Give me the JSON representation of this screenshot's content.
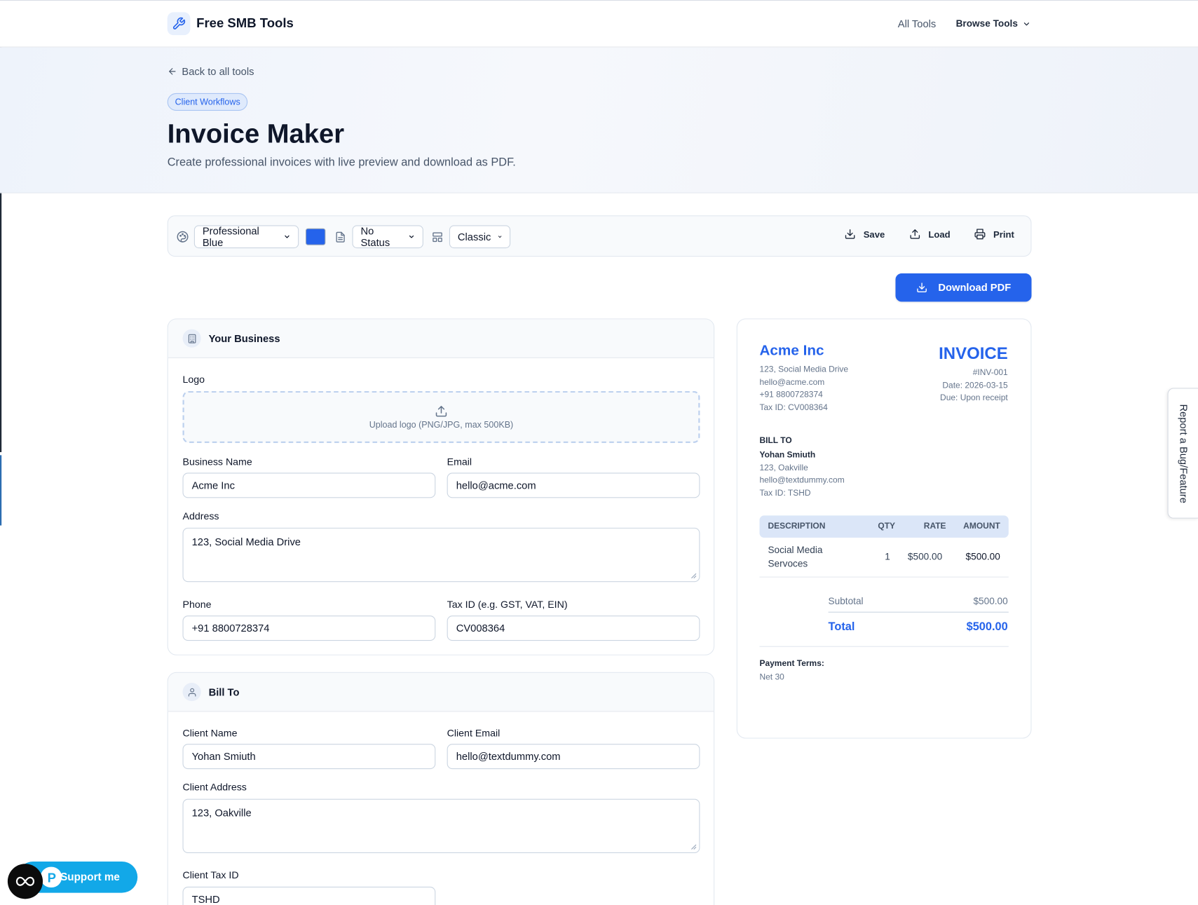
{
  "nav": {
    "brand": "Free SMB Tools",
    "all_tools": "All Tools",
    "browse_tools": "Browse Tools"
  },
  "hero": {
    "back": "Back to all tools",
    "category": "Client Workflows",
    "title": "Invoice Maker",
    "subtitle": "Create professional invoices with live preview and download as PDF."
  },
  "toolbar": {
    "theme": "Professional Blue",
    "accent_color": "#2563eb",
    "status": "No Status",
    "layout": "Classic",
    "save": "Save",
    "load": "Load",
    "print": "Print",
    "download_pdf": "Download PDF"
  },
  "business": {
    "heading": "Your Business",
    "logo_label": "Logo",
    "upload_hint": "Upload logo (PNG/JPG, max 500KB)",
    "name_label": "Business Name",
    "name_value": "Acme Inc",
    "email_label": "Email",
    "email_value": "hello@acme.com",
    "address_label": "Address",
    "address_value": "123, Social Media Drive",
    "phone_label": "Phone",
    "phone_value": "+91 8800728374",
    "tax_label": "Tax ID (e.g. GST, VAT, EIN)",
    "tax_value": "CV008364"
  },
  "bill_to": {
    "heading": "Bill To",
    "name_label": "Client Name",
    "name_value": "Yohan Smiuth",
    "email_label": "Client Email",
    "email_value": "hello@textdummy.com",
    "address_label": "Client Address",
    "address_value": "123, Oakville",
    "tax_label": "Client Tax ID",
    "tax_value": "TSHD"
  },
  "preview": {
    "company": "Acme Inc",
    "address": "123, Social Media Drive",
    "email": "hello@acme.com",
    "phone": "+91 8800728374",
    "tax": "Tax ID: CV008364",
    "invoice_title": "INVOICE",
    "number": "#INV-001",
    "date": "Date: 2026-03-15",
    "due": "Due: Upon receipt",
    "bill_to_label": "BILL TO",
    "client_name": "Yohan Smiuth",
    "client_address": "123, Oakville",
    "client_email": "hello@textdummy.com",
    "client_tax": "Tax ID: TSHD",
    "columns": [
      "DESCRIPTION",
      "QTY",
      "RATE",
      "AMOUNT"
    ],
    "items": [
      {
        "description_line1": "Social Media",
        "description_line2": "Servoces",
        "qty": "1",
        "rate": "$500.00",
        "amount": "$500.00"
      }
    ],
    "subtotal_label": "Subtotal",
    "subtotal_value": "$500.00",
    "total_label": "Total",
    "total_value": "$500.00",
    "payment_terms_label": "Payment Terms:",
    "payment_terms_value": "Net 30"
  },
  "side_tab": "Report a Bug/Feature",
  "support": "Support me"
}
